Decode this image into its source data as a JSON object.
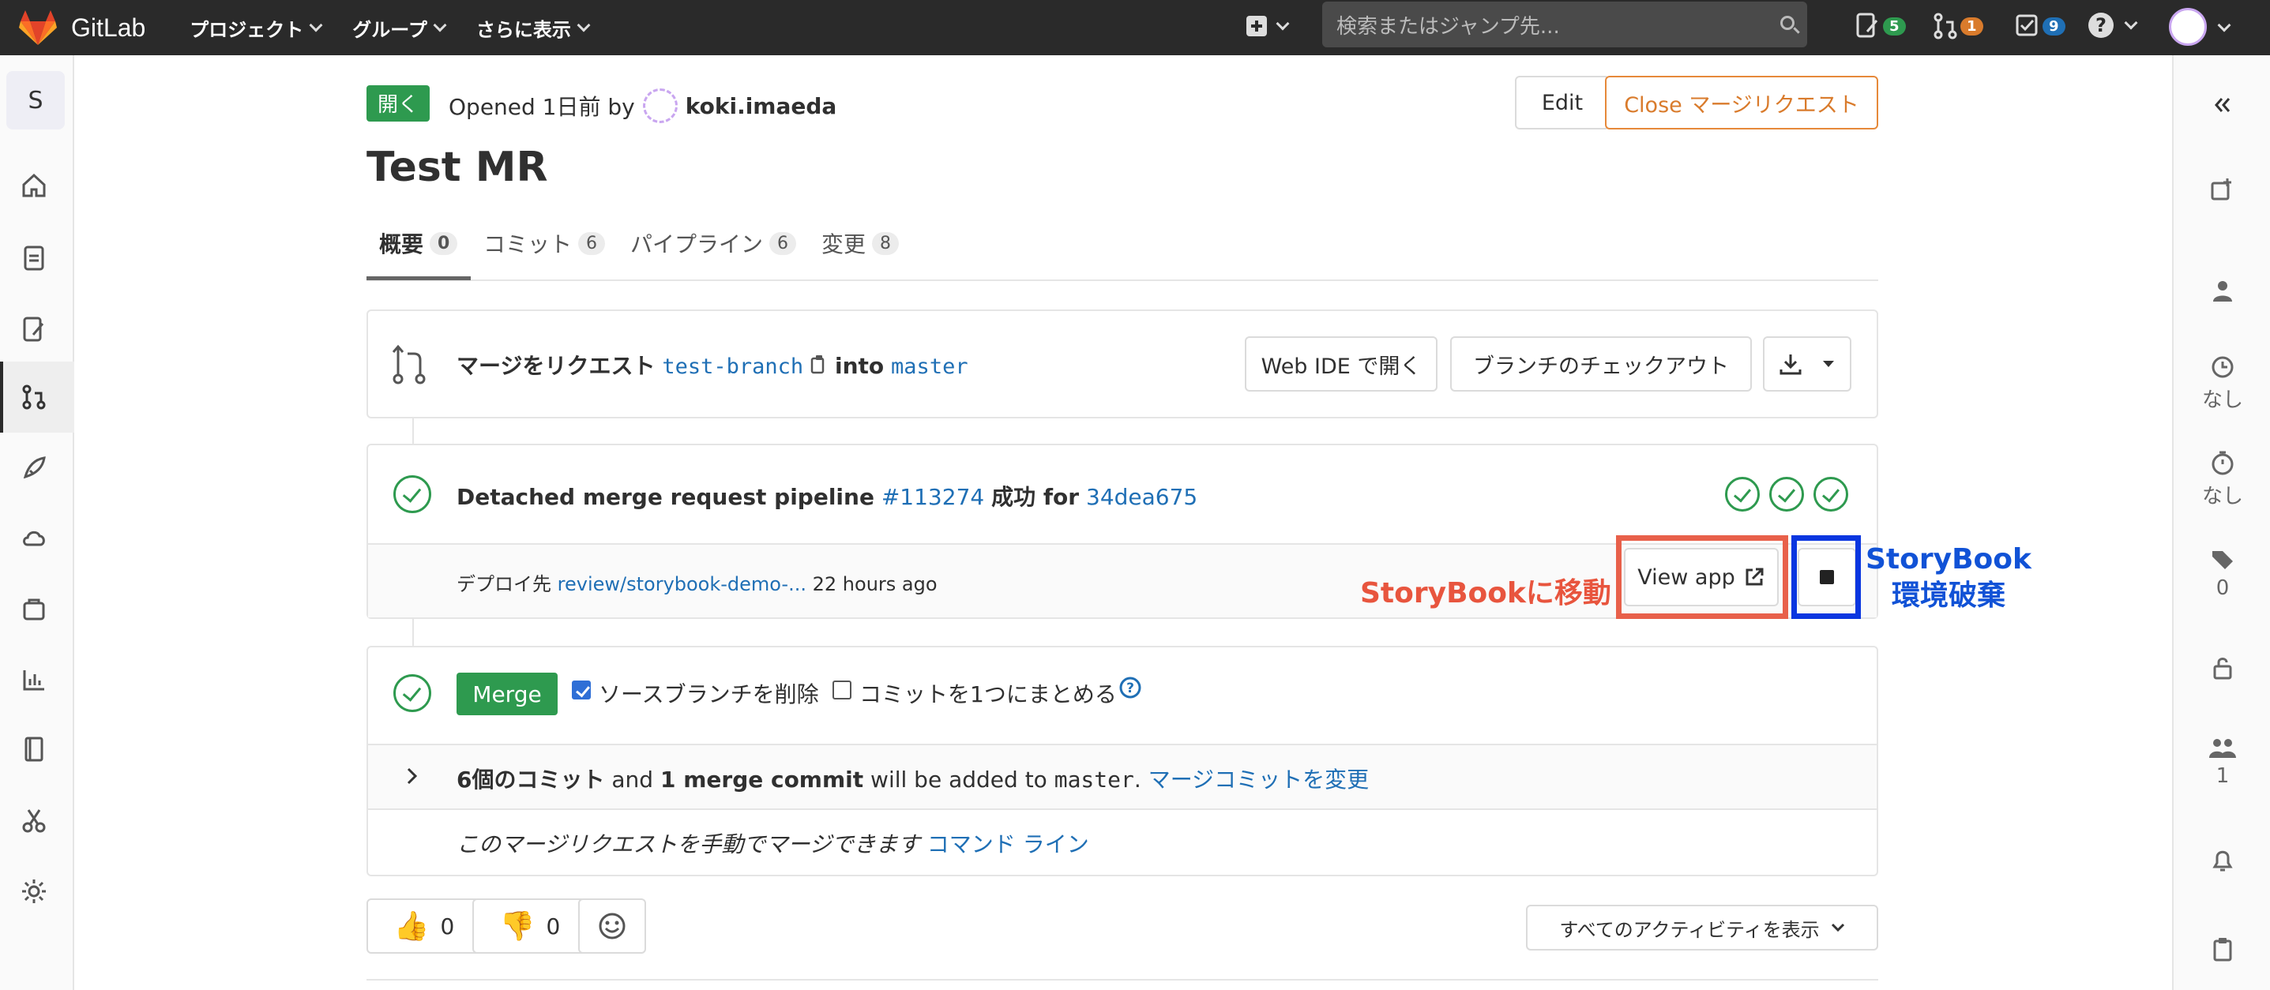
{
  "topnav": {
    "logo_text": "GitLab",
    "projects": "プロジェクト",
    "groups": "グループ",
    "more": "さらに表示",
    "search_placeholder": "検索またはジャンプ先...",
    "issues_count": "5",
    "mr_count": "1",
    "todo_count": "9"
  },
  "sidebar": {
    "project_initial": "S"
  },
  "mr": {
    "status": "開く",
    "opened_text": "Opened 1日前 by",
    "author": "koki.imaeda",
    "edit_label": "Edit",
    "close_label": "Close マージリクエスト",
    "title": "Test MR",
    "tabs": [
      {
        "label": "概要",
        "count": "0"
      },
      {
        "label": "コミット",
        "count": "6"
      },
      {
        "label": "パイプライン",
        "count": "6"
      },
      {
        "label": "変更",
        "count": "8"
      }
    ]
  },
  "branch": {
    "request_label": "マージをリクエスト",
    "source": "test-branch",
    "into": "into",
    "target": "master",
    "web_ide": "Web IDE で開く",
    "checkout": "ブランチのチェックアウト"
  },
  "pipeline": {
    "prefix": "Detached merge request pipeline",
    "id": "#113274",
    "status": "成功 for",
    "commit": "34dea675",
    "deploy_prefix": "デプロイ先",
    "deploy_env": "review/storybook-demo-...",
    "deploy_time": "22 hours ago",
    "view_app": "View app"
  },
  "annotations": {
    "move": "StoryBookに移動",
    "destroy_line1": "StoryBook",
    "destroy_line2": "環境破棄"
  },
  "merge": {
    "button": "Merge",
    "delete_branch": "ソースブランチを削除",
    "squash": "コミットを1つにまとめる",
    "commits_bold": "6個のコミット",
    "and": "and",
    "merge_commit_bold": "1 merge commit",
    "will_be_added": "will be added to",
    "target": "master",
    "period": ".",
    "modify_link": "マージコミットを変更",
    "manual_text": "このマージリクエストを手動でマージできます",
    "command_line": "コマンド ライン"
  },
  "reactions": {
    "thumbs_up": "0",
    "thumbs_down": "0",
    "activity_filter": "すべてのアクティビティを表示"
  },
  "right_sidebar": {
    "milestone": "なし",
    "time_tracking": "なし",
    "labels": "0",
    "participants": "1"
  }
}
